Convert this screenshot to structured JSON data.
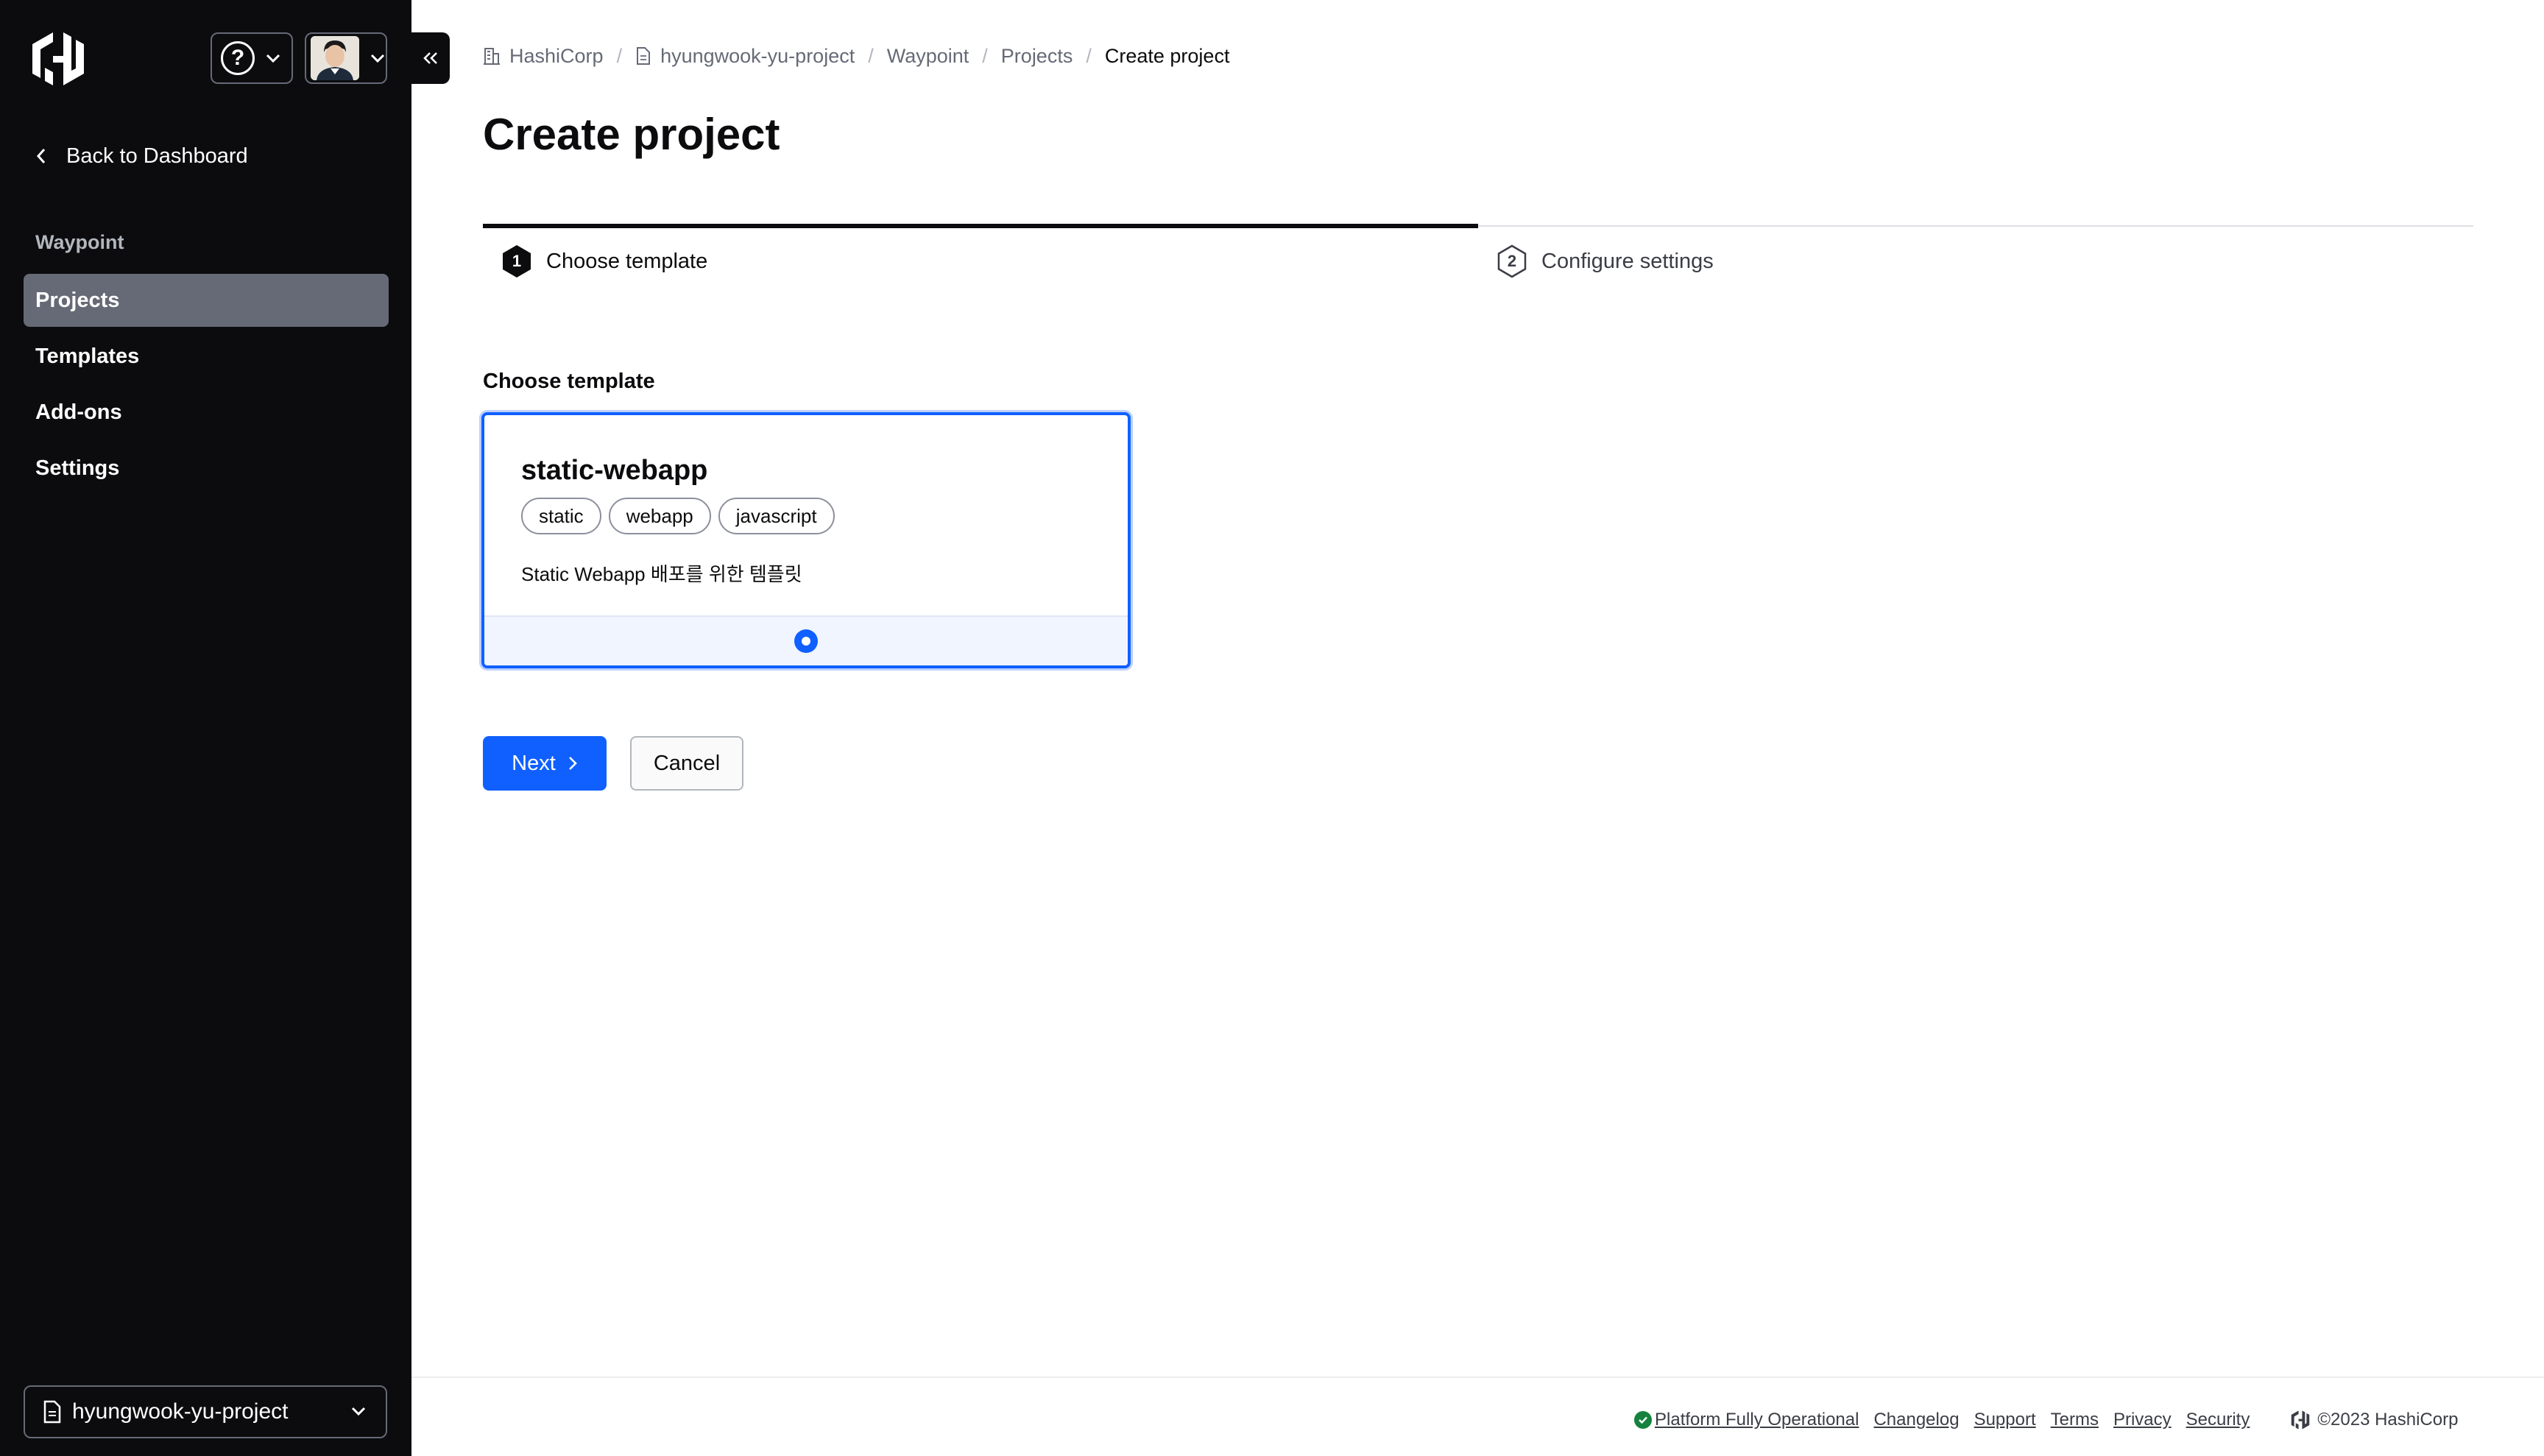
{
  "sidebar": {
    "back_label": "Back to Dashboard",
    "section_heading": "Waypoint",
    "items": [
      {
        "label": "Projects",
        "active": true
      },
      {
        "label": "Templates",
        "active": false
      },
      {
        "label": "Add-ons",
        "active": false
      },
      {
        "label": "Settings",
        "active": false
      }
    ],
    "project_switcher": "hyungwook-yu-project"
  },
  "header": {
    "help_icon": "question-circle-icon",
    "help_glyph": "?"
  },
  "breadcrumb": [
    {
      "label": "HashiCorp",
      "icon": "building-icon"
    },
    {
      "label": "hyungwook-yu-project",
      "icon": "file-icon"
    },
    {
      "label": "Waypoint"
    },
    {
      "label": "Projects"
    },
    {
      "label": "Create project",
      "current": true
    }
  ],
  "breadcrumb_separator": "/",
  "page_title": "Create project",
  "stepper": {
    "steps": [
      {
        "number": "1",
        "label": "Choose template",
        "active": true
      },
      {
        "number": "2",
        "label": "Configure settings",
        "active": false
      }
    ]
  },
  "form": {
    "section_label": "Choose template",
    "template": {
      "name": "static-webapp",
      "tags": [
        "static",
        "webapp",
        "javascript"
      ],
      "description": "Static Webapp 배포를 위한 템플릿",
      "selected": true
    },
    "next_label": "Next",
    "cancel_label": "Cancel"
  },
  "footer": {
    "status": "Platform Fully Operational",
    "links": [
      "Changelog",
      "Support",
      "Terms",
      "Privacy",
      "Security"
    ],
    "copyright": "©2023 HashiCorp"
  },
  "colors": {
    "sidebar_bg": "#0c0c0e",
    "accent": "#1060ff",
    "status_ok": "#15823e"
  }
}
